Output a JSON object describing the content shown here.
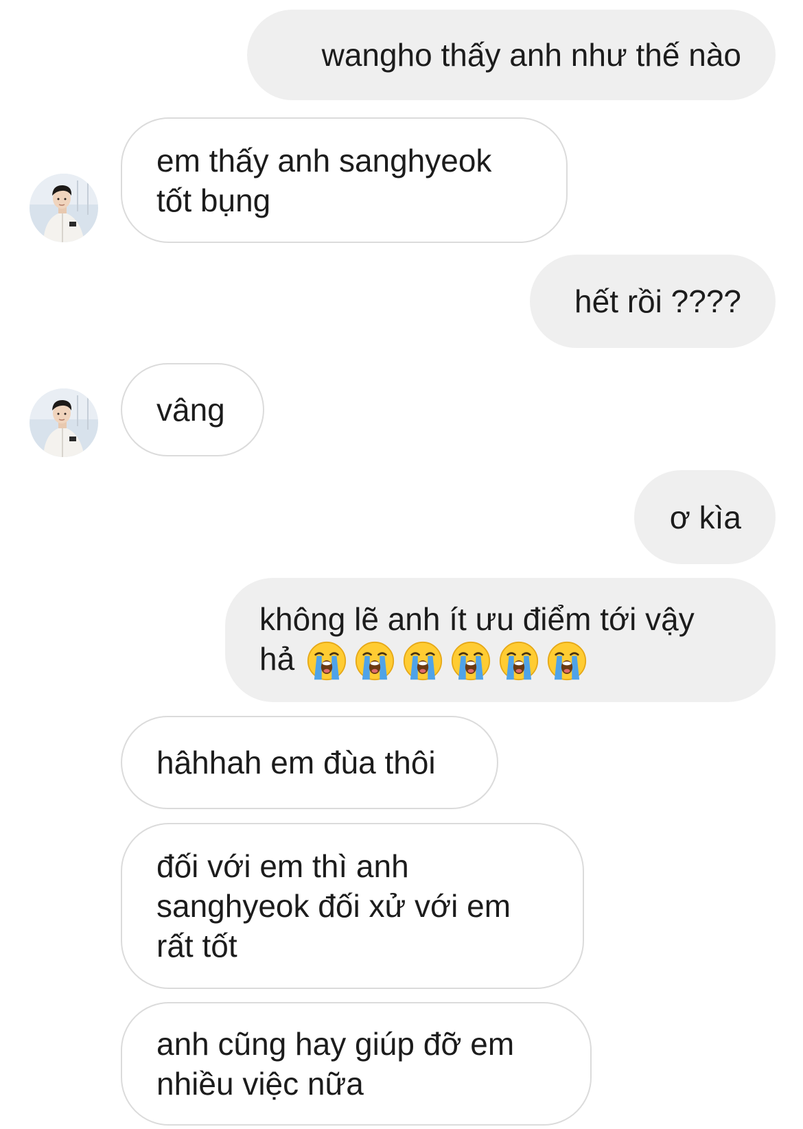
{
  "chat": {
    "avatar_icon": "user-avatar-photo",
    "messages": [
      {
        "from": "me",
        "lines": [
          "wangho thấy anh như thế nào"
        ]
      },
      {
        "from": "other",
        "lines": [
          "em thấy anh sanghyeok",
          "tốt bụng"
        ]
      },
      {
        "from": "me",
        "lines": [
          "hết rồi ????"
        ]
      },
      {
        "from": "other",
        "lines": [
          "vâng"
        ]
      },
      {
        "from": "me",
        "lines": [
          "ơ kìa"
        ]
      },
      {
        "from": "me",
        "lines": [
          "không lẽ anh ít ưu điểm tới vậy",
          "hả"
        ],
        "emoji": "loudly-crying-face",
        "emoji_count": 6
      },
      {
        "from": "other",
        "lines": [
          "hâhhah em đùa thôi"
        ]
      },
      {
        "from": "other",
        "lines": [
          "đối với em thì anh",
          "sanghyeok đối xử với em",
          "rất tốt"
        ]
      },
      {
        "from": "other",
        "lines": [
          "anh cũng hay giúp đỡ em",
          "nhiều việc nữa"
        ]
      }
    ]
  },
  "colors": {
    "sent_bubble": "#efefef",
    "received_border": "#dbdbdb",
    "text": "#1c1c1c"
  }
}
